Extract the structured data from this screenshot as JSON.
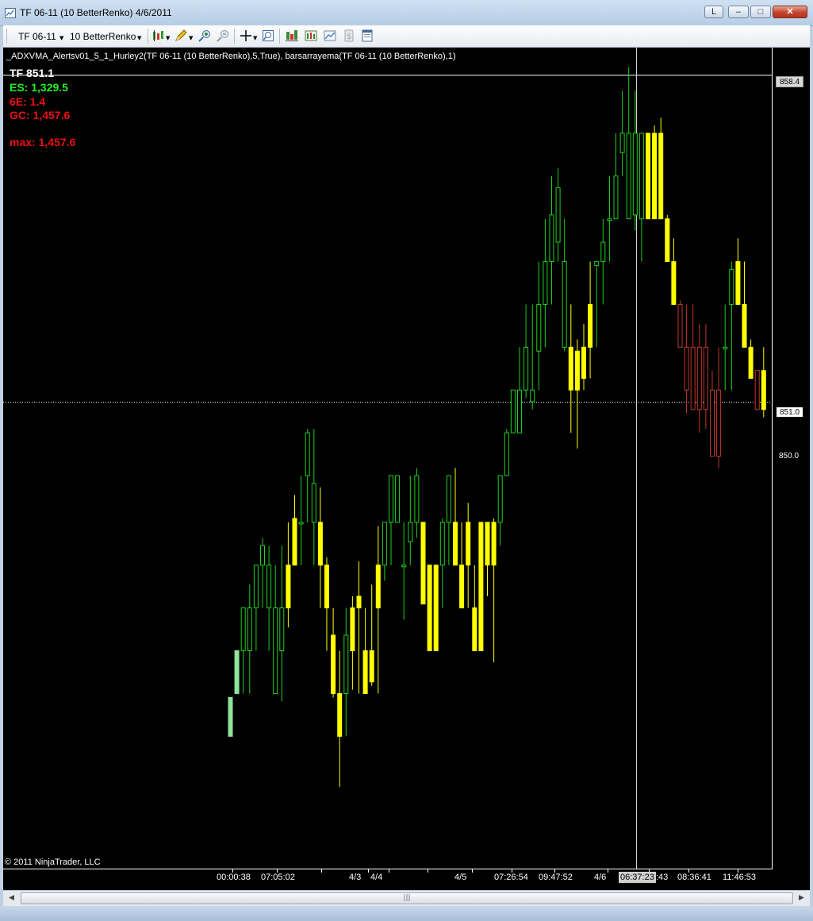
{
  "window": {
    "title": "TF 06-11 (10 BetterRenko)  4/6/2011",
    "link_label": "L",
    "minimize_glyph": "–",
    "maximize_glyph": "□",
    "close_glyph": "✕"
  },
  "toolbar": {
    "instrument": "TF 06-11",
    "period": "10 BetterRenko",
    "icons": [
      "chart-style-icon",
      "drawing-pencil-icon",
      "zoom-in-icon",
      "zoom-out-icon",
      "crosshair-icon",
      "data-box-icon",
      "bar-chart-icon",
      "indicators-icon",
      "strategies-icon",
      "chart-properties-icon"
    ]
  },
  "chart": {
    "indicator_label": "_ADXVMA_Alertsv01_5_1_Hurley2(TF 06-11 (10 BetterRenko),5,True), barsarrayema(TF 06-11 (10 BetterRenko),1)",
    "info_lines": [
      {
        "text": "TF  851.1",
        "color": "#ffffff"
      },
      {
        "text": "ES: 1,329.5",
        "color": "#22ee22"
      },
      {
        "text": "6E: 1.4",
        "color": "#ee1111"
      },
      {
        "text": "GC: 1,457.6",
        "color": "#ee1111"
      },
      {
        "text": "max: 1,457.6",
        "color": "#ee1111"
      }
    ],
    "price_tag_top": "858.4",
    "price_tag_last": "851.0",
    "price_label_850": "850.0",
    "copyright": "© 2011 NinjaTrader, LLC",
    "time_labels": [
      "00:00:38",
      "07:05:02",
      "4/3",
      "4/4",
      "4/5",
      "07:26:54",
      "09:47:52",
      "4/6",
      ":43",
      "08:36:41",
      "11:46:53"
    ],
    "crosshair_time": "06:37:23",
    "colors": {
      "background": "#000000",
      "up_outline": "#1fd01f",
      "neutral_body": "#ffff00",
      "down_outline": "#c0392b",
      "first_bar": "#8fe39a",
      "hline": "#ffffff"
    }
  },
  "chart_data": {
    "type": "candlestick",
    "instrument": "TF 06-11",
    "title": "",
    "ylim": [
      838.0,
      859.1
    ],
    "grid": false,
    "reference_lines": [
      858.4,
      850.0
    ],
    "last_price": 851.0,
    "crosshair_x_time": "06:37:23",
    "candles": [
      {
        "o": 842.4,
        "h": 842.4,
        "l": 841.4,
        "c": 841.4,
        "type": "first"
      },
      {
        "o": 843.6,
        "h": 843.6,
        "l": 842.5,
        "c": 842.5,
        "type": "first"
      },
      {
        "o": 844.7,
        "h": 844.7,
        "l": 842.5,
        "c": 843.6,
        "type": "up"
      },
      {
        "o": 843.6,
        "h": 845.3,
        "l": 842.5,
        "c": 844.7,
        "type": "up"
      },
      {
        "o": 845.8,
        "h": 845.8,
        "l": 843.6,
        "c": 844.7,
        "type": "up"
      },
      {
        "o": 846.3,
        "h": 846.5,
        "l": 844.7,
        "c": 845.8,
        "type": "up"
      },
      {
        "o": 844.7,
        "h": 846.3,
        "l": 843.6,
        "c": 845.8,
        "type": "up"
      },
      {
        "o": 844.7,
        "h": 845.8,
        "l": 842.5,
        "c": 842.5,
        "type": "up"
      },
      {
        "o": 843.6,
        "h": 846.3,
        "l": 842.3,
        "c": 844.7,
        "type": "up"
      },
      {
        "o": 845.8,
        "h": 846.9,
        "l": 844.2,
        "c": 844.7,
        "type": "neutral"
      },
      {
        "o": 847.0,
        "h": 847.6,
        "l": 845.8,
        "c": 845.8,
        "type": "neutral"
      },
      {
        "o": 846.9,
        "h": 848.1,
        "l": 845.8,
        "c": 846.9,
        "type": "up"
      },
      {
        "o": 849.2,
        "h": 849.3,
        "l": 846.9,
        "c": 848.1,
        "type": "up"
      },
      {
        "o": 846.9,
        "h": 849.3,
        "l": 845.8,
        "c": 847.9,
        "type": "up"
      },
      {
        "o": 845.8,
        "h": 847.8,
        "l": 844.7,
        "c": 846.9,
        "type": "neutral"
      },
      {
        "o": 844.7,
        "h": 846.0,
        "l": 843.6,
        "c": 845.8,
        "type": "neutral"
      },
      {
        "o": 842.5,
        "h": 844.7,
        "l": 842.4,
        "c": 844.0,
        "type": "neutral"
      },
      {
        "o": 841.4,
        "h": 843.6,
        "l": 840.1,
        "c": 842.5,
        "type": "neutral"
      },
      {
        "o": 842.5,
        "h": 844.7,
        "l": 841.4,
        "c": 844.0,
        "type": "up"
      },
      {
        "o": 843.6,
        "h": 845.0,
        "l": 842.6,
        "c": 844.7,
        "type": "neutral"
      },
      {
        "o": 845.0,
        "h": 845.9,
        "l": 842.5,
        "c": 844.7,
        "type": "neutral"
      },
      {
        "o": 842.5,
        "h": 844.7,
        "l": 842.5,
        "c": 843.6,
        "type": "neutral"
      },
      {
        "o": 843.6,
        "h": 845.3,
        "l": 842.7,
        "c": 842.8,
        "type": "neutral"
      },
      {
        "o": 844.7,
        "h": 846.8,
        "l": 842.5,
        "c": 845.8,
        "type": "neutral"
      },
      {
        "o": 845.8,
        "h": 846.9,
        "l": 845.4,
        "c": 846.9,
        "type": "up"
      },
      {
        "o": 846.9,
        "h": 848.1,
        "l": 845.8,
        "c": 848.1,
        "type": "up"
      },
      {
        "o": 848.1,
        "h": 848.1,
        "l": 846.9,
        "c": 846.9,
        "type": "up"
      },
      {
        "o": 845.8,
        "h": 846.9,
        "l": 844.4,
        "c": 845.8,
        "type": "up"
      },
      {
        "o": 846.9,
        "h": 848.1,
        "l": 845.8,
        "c": 846.4,
        "type": "up"
      },
      {
        "o": 848.1,
        "h": 848.3,
        "l": 846.5,
        "c": 846.9,
        "type": "up"
      },
      {
        "o": 846.9,
        "h": 846.9,
        "l": 844.8,
        "c": 844.8,
        "type": "neutral"
      },
      {
        "o": 845.8,
        "h": 845.8,
        "l": 843.6,
        "c": 843.6,
        "type": "neutral"
      },
      {
        "o": 843.6,
        "h": 845.8,
        "l": 843.6,
        "c": 845.8,
        "type": "neutral"
      },
      {
        "o": 845.8,
        "h": 847.0,
        "l": 844.7,
        "c": 846.9,
        "type": "up"
      },
      {
        "o": 846.9,
        "h": 848.0,
        "l": 845.8,
        "c": 848.1,
        "type": "up"
      },
      {
        "o": 846.9,
        "h": 848.3,
        "l": 845.8,
        "c": 845.8,
        "type": "neutral"
      },
      {
        "o": 845.8,
        "h": 846.9,
        "l": 844.7,
        "c": 844.7,
        "type": "neutral"
      },
      {
        "o": 846.9,
        "h": 847.4,
        "l": 844.7,
        "c": 845.8,
        "type": "neutral"
      },
      {
        "o": 844.7,
        "h": 845.8,
        "l": 843.6,
        "c": 843.6,
        "type": "neutral"
      },
      {
        "o": 843.6,
        "h": 845.8,
        "l": 843.6,
        "c": 846.9,
        "type": "neutral"
      },
      {
        "o": 846.9,
        "h": 846.9,
        "l": 845.0,
        "c": 845.8,
        "type": "neutral"
      },
      {
        "o": 845.8,
        "h": 847.0,
        "l": 843.3,
        "c": 846.9,
        "type": "neutral"
      },
      {
        "o": 848.1,
        "h": 848.1,
        "l": 846.3,
        "c": 846.9,
        "type": "up"
      },
      {
        "o": 849.2,
        "h": 849.3,
        "l": 848.1,
        "c": 848.1,
        "type": "up"
      },
      {
        "o": 850.3,
        "h": 850.3,
        "l": 849.2,
        "c": 849.2,
        "type": "up"
      },
      {
        "o": 849.2,
        "h": 851.4,
        "l": 849.2,
        "c": 850.3,
        "type": "up"
      },
      {
        "o": 851.4,
        "h": 852.5,
        "l": 850.1,
        "c": 850.3,
        "type": "up"
      },
      {
        "o": 850.3,
        "h": 852.5,
        "l": 849.8,
        "c": 850.0,
        "type": "up"
      },
      {
        "o": 851.3,
        "h": 853.6,
        "l": 850.3,
        "c": 852.5,
        "type": "up"
      },
      {
        "o": 852.5,
        "h": 854.7,
        "l": 851.4,
        "c": 853.6,
        "type": "up"
      },
      {
        "o": 853.6,
        "h": 855.8,
        "l": 852.5,
        "c": 854.8,
        "type": "up"
      },
      {
        "o": 855.5,
        "h": 856.0,
        "l": 853.6,
        "c": 854.1,
        "type": "up"
      },
      {
        "o": 853.6,
        "h": 854.7,
        "l": 851.3,
        "c": 851.4,
        "type": "up"
      },
      {
        "o": 851.4,
        "h": 852.5,
        "l": 849.2,
        "c": 850.3,
        "type": "neutral"
      },
      {
        "o": 850.3,
        "h": 851.6,
        "l": 848.8,
        "c": 851.3,
        "type": "neutral"
      },
      {
        "o": 851.4,
        "h": 852.0,
        "l": 850.3,
        "c": 850.6,
        "type": "neutral"
      },
      {
        "o": 852.5,
        "h": 853.6,
        "l": 850.6,
        "c": 851.4,
        "type": "neutral"
      },
      {
        "o": 853.6,
        "h": 853.6,
        "l": 851.4,
        "c": 853.5,
        "type": "up"
      },
      {
        "o": 854.1,
        "h": 854.7,
        "l": 852.5,
        "c": 853.6,
        "type": "up"
      },
      {
        "o": 854.7,
        "h": 855.8,
        "l": 853.6,
        "c": 854.7,
        "type": "up"
      },
      {
        "o": 855.8,
        "h": 856.9,
        "l": 854.7,
        "c": 854.7,
        "type": "up"
      },
      {
        "o": 856.4,
        "h": 858.0,
        "l": 855.8,
        "c": 856.9,
        "type": "up"
      },
      {
        "o": 856.9,
        "h": 858.6,
        "l": 854.9,
        "c": 854.7,
        "type": "up"
      },
      {
        "o": 856.9,
        "h": 858.0,
        "l": 854.4,
        "c": 854.8,
        "type": "up"
      },
      {
        "o": 854.7,
        "h": 856.9,
        "l": 853.6,
        "c": 856.9,
        "type": "up"
      },
      {
        "o": 856.9,
        "h": 856.9,
        "l": 854.7,
        "c": 854.7,
        "type": "neutral"
      },
      {
        "o": 856.9,
        "h": 857.1,
        "l": 854.8,
        "c": 854.7,
        "type": "neutral"
      },
      {
        "o": 856.9,
        "h": 857.3,
        "l": 854.7,
        "c": 854.7,
        "type": "neutral"
      },
      {
        "o": 854.7,
        "h": 854.8,
        "l": 853.6,
        "c": 853.6,
        "type": "neutral"
      },
      {
        "o": 853.6,
        "h": 854.2,
        "l": 852.5,
        "c": 852.5,
        "type": "neutral"
      },
      {
        "o": 852.5,
        "h": 852.6,
        "l": 851.4,
        "c": 851.4,
        "type": "down"
      },
      {
        "o": 851.4,
        "h": 852.5,
        "l": 849.7,
        "c": 850.3,
        "type": "down"
      },
      {
        "o": 851.4,
        "h": 852.5,
        "l": 849.8,
        "c": 849.8,
        "type": "down"
      },
      {
        "o": 851.4,
        "h": 852.0,
        "l": 849.2,
        "c": 849.8,
        "type": "down"
      },
      {
        "o": 851.4,
        "h": 852.0,
        "l": 849.3,
        "c": 849.8,
        "type": "down"
      },
      {
        "o": 850.3,
        "h": 850.8,
        "l": 848.6,
        "c": 848.6,
        "type": "down"
      },
      {
        "o": 850.3,
        "h": 851.4,
        "l": 848.3,
        "c": 848.6,
        "type": "down"
      },
      {
        "o": 851.4,
        "h": 852.5,
        "l": 850.3,
        "c": 851.4,
        "type": "up"
      },
      {
        "o": 852.5,
        "h": 853.6,
        "l": 850.3,
        "c": 853.4,
        "type": "up"
      },
      {
        "o": 853.6,
        "h": 854.2,
        "l": 852.5,
        "c": 852.5,
        "type": "neutral"
      },
      {
        "o": 852.5,
        "h": 853.6,
        "l": 851.4,
        "c": 851.4,
        "type": "neutral"
      },
      {
        "o": 851.4,
        "h": 851.6,
        "l": 850.6,
        "c": 850.6,
        "type": "neutral"
      },
      {
        "o": 850.8,
        "h": 850.8,
        "l": 849.8,
        "c": 849.8,
        "type": "down"
      },
      {
        "o": 850.8,
        "h": 851.4,
        "l": 849.6,
        "c": 849.8,
        "type": "neutral"
      }
    ]
  }
}
